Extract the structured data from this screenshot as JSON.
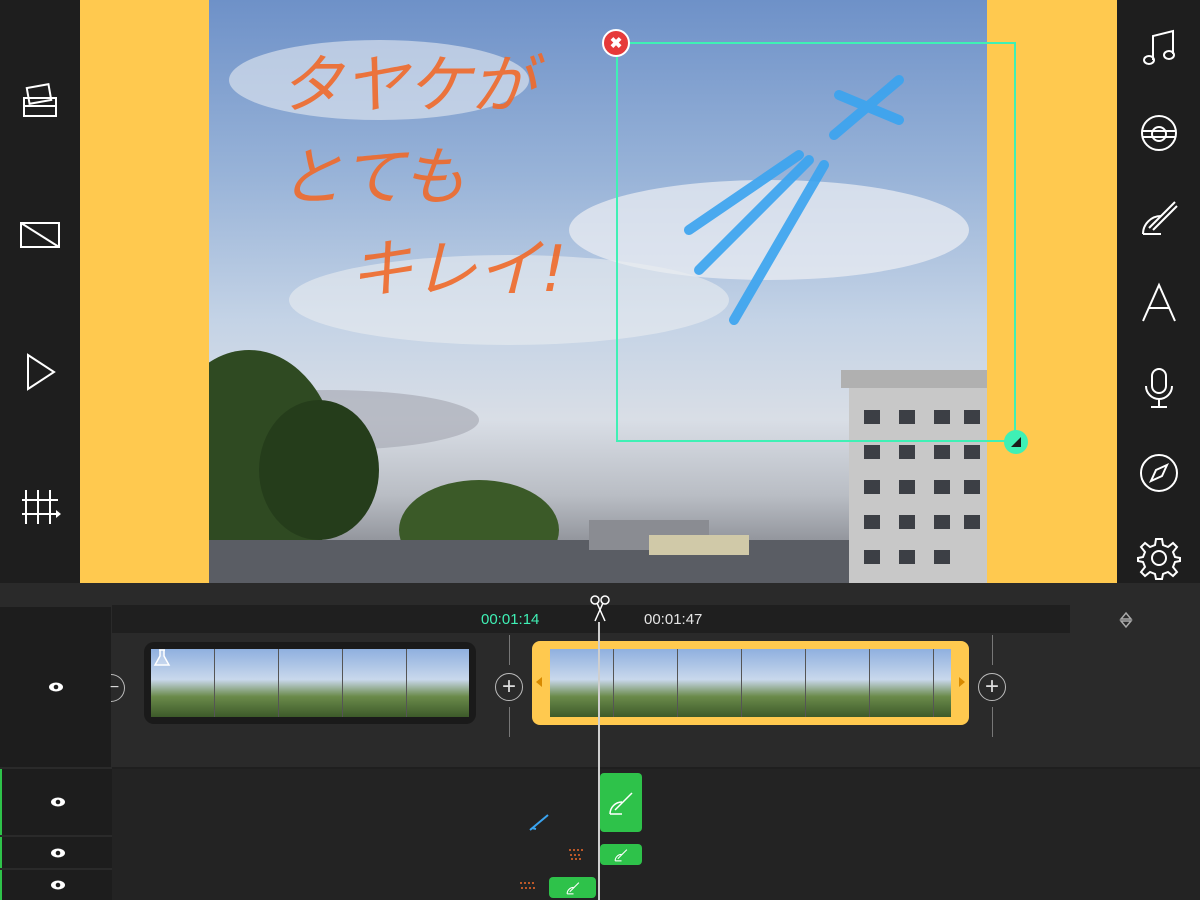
{
  "toolbar_left": {
    "icons": [
      "media-library-icon",
      "aspect-ratio-icon",
      "play-icon",
      "timeline-editor-icon"
    ]
  },
  "toolbar_right": {
    "icons": [
      "music-icon",
      "sticker-icon",
      "brush-icon",
      "text-icon",
      "microphone-icon",
      "compass-icon",
      "settings-icon"
    ]
  },
  "preview": {
    "background_color": "#ffc94f",
    "selection_color": "#3ff0b5",
    "close_label": "✖",
    "drawing_text_lines": [
      "タヤケが",
      "とても",
      "キレイ!"
    ]
  },
  "timeline": {
    "current_time": "00:01:14",
    "end_time": "00:01:47",
    "current_time_color": "#3ff0b5",
    "tracks": [
      {
        "visibility_icon": "eye-icon"
      },
      {
        "visibility_icon": "eye-icon"
      },
      {
        "visibility_icon": "eye-icon"
      },
      {
        "visibility_icon": "eye-icon"
      }
    ],
    "add_label": "+",
    "remove_label": "−"
  }
}
